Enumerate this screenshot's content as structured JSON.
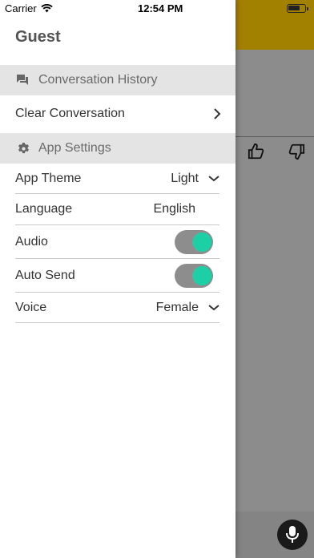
{
  "status_bar": {
    "carrier": "Carrier",
    "time": "12:54 PM"
  },
  "drawer": {
    "user_name": "Guest",
    "history_section": {
      "label": "Conversation History",
      "icon": "chat-icon"
    },
    "clear_conversation": {
      "label": "Clear Conversation"
    },
    "settings_section": {
      "label": "App Settings",
      "icon": "gear-icon"
    },
    "settings": {
      "theme": {
        "label": "App Theme",
        "value": "Light"
      },
      "language": {
        "label": "Language",
        "value": "English"
      },
      "audio": {
        "label": "Audio",
        "enabled": true
      },
      "auto_send": {
        "label": "Auto Send",
        "enabled": true
      },
      "voice": {
        "label": "Voice",
        "value": "Female"
      }
    }
  },
  "colors": {
    "accent": "#1dcfa5",
    "header": "#a38100",
    "toggle_track": "#8d8d8d"
  }
}
